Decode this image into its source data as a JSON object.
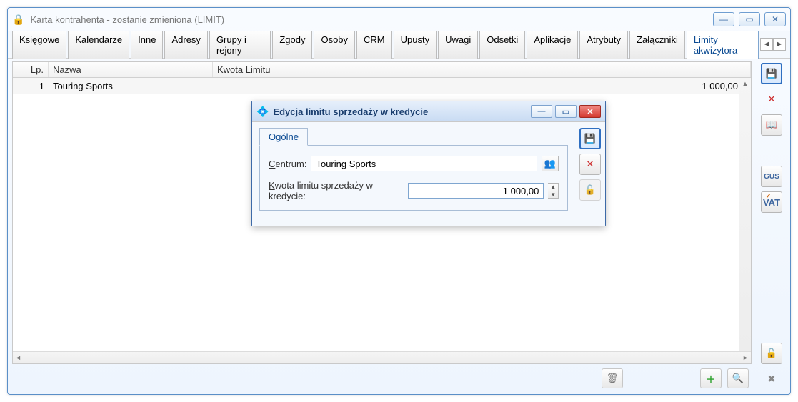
{
  "window": {
    "title": "Karta kontrahenta - zostanie zmieniona (LIMIT)"
  },
  "tabs": [
    {
      "label": "Księgowe"
    },
    {
      "label": "Kalendarze"
    },
    {
      "label": "Inne"
    },
    {
      "label": "Adresy"
    },
    {
      "label": "Grupy i rejony"
    },
    {
      "label": "Zgody"
    },
    {
      "label": "Osoby"
    },
    {
      "label": "CRM"
    },
    {
      "label": "Upusty"
    },
    {
      "label": "Uwagi"
    },
    {
      "label": "Odsetki"
    },
    {
      "label": "Aplikacje"
    },
    {
      "label": "Atrybuty"
    },
    {
      "label": "Załączniki"
    },
    {
      "label": "Limity akwizytora",
      "active": true
    }
  ],
  "grid": {
    "headers": {
      "lp": "Lp.",
      "nazwa": "Nazwa",
      "kwota": "Kwota Limitu"
    },
    "rows": [
      {
        "lp": "1",
        "nazwa": "Touring Sports",
        "kwota": "1 000,00"
      }
    ]
  },
  "dialog": {
    "title": "Edycja limitu sprzedaży w kredycie",
    "tab": "Ogólne",
    "centrum_label": "entrum:",
    "centrum_value": "Touring Sports",
    "kwota_label": "wota limitu sprzedaży w kredycie:",
    "kwota_value": "1 000,00"
  },
  "side": {
    "gus": "GUS",
    "vat": "VAT"
  }
}
